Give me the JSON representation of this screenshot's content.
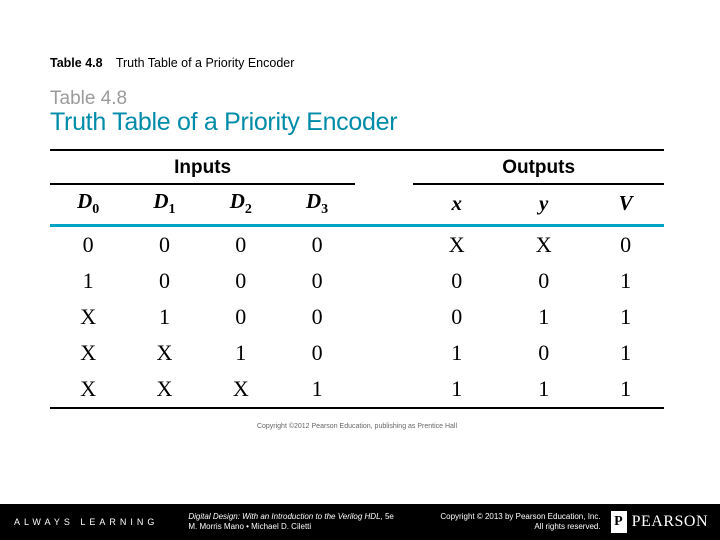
{
  "caption": {
    "number": "Table 4.8",
    "text": "Truth Table of a Priority Encoder"
  },
  "figure": {
    "label": "Table 4.8",
    "title": "Truth Table of a Priority Encoder"
  },
  "headers": {
    "group_inputs": "Inputs",
    "group_outputs": "Outputs",
    "cols": [
      "D",
      "D",
      "D",
      "D",
      "x",
      "y",
      "V"
    ],
    "subs": [
      "0",
      "1",
      "2",
      "3",
      "",
      "",
      ""
    ]
  },
  "chart_data": {
    "type": "table",
    "title": "Truth Table of a Priority Encoder",
    "columns": [
      "D0",
      "D1",
      "D2",
      "D3",
      "x",
      "y",
      "V"
    ],
    "rows": [
      [
        "0",
        "0",
        "0",
        "0",
        "X",
        "X",
        "0"
      ],
      [
        "1",
        "0",
        "0",
        "0",
        "0",
        "0",
        "1"
      ],
      [
        "X",
        "1",
        "0",
        "0",
        "0",
        "1",
        "1"
      ],
      [
        "X",
        "X",
        "1",
        "0",
        "1",
        "0",
        "1"
      ],
      [
        "X",
        "X",
        "X",
        "1",
        "1",
        "1",
        "1"
      ]
    ]
  },
  "imprint": "Copyright ©2012 Pearson Education, publishing as Prentice Hall",
  "footer": {
    "always": "ALWAYS LEARNING",
    "book_title": "Digital Design: With an Introduction to the Verilog HDL",
    "edition": ", 5e",
    "authors": "M. Morris Mano • Michael D. Ciletti",
    "copyright_line1": "Copyright © 2013 by Pearson Education, Inc.",
    "copyright_line2": "All rights reserved.",
    "brand": "PEARSON"
  }
}
